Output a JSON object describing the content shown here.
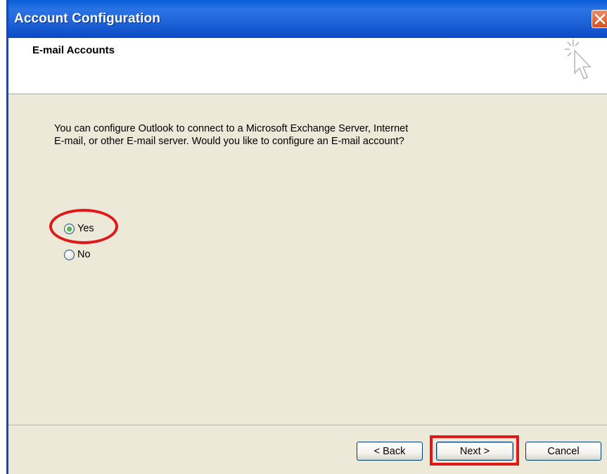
{
  "window": {
    "title": "Account Configuration"
  },
  "header": {
    "title": "E-mail Accounts",
    "icon": "cursor-sparkle-icon"
  },
  "content": {
    "question": "You can configure Outlook to connect to a Microsoft Exchange Server, Internet\nE-mail, or other E-mail server.  Would you like to configure an E-mail account?",
    "options": [
      {
        "label": "Yes",
        "selected": true
      },
      {
        "label": "No",
        "selected": false
      }
    ]
  },
  "buttons": {
    "back": "< Back",
    "next": "Next >",
    "cancel": "Cancel"
  },
  "colors": {
    "titlebar": "#0a5bd6",
    "dialog_bg": "#ece9d8",
    "annotation_red": "#e01818"
  }
}
